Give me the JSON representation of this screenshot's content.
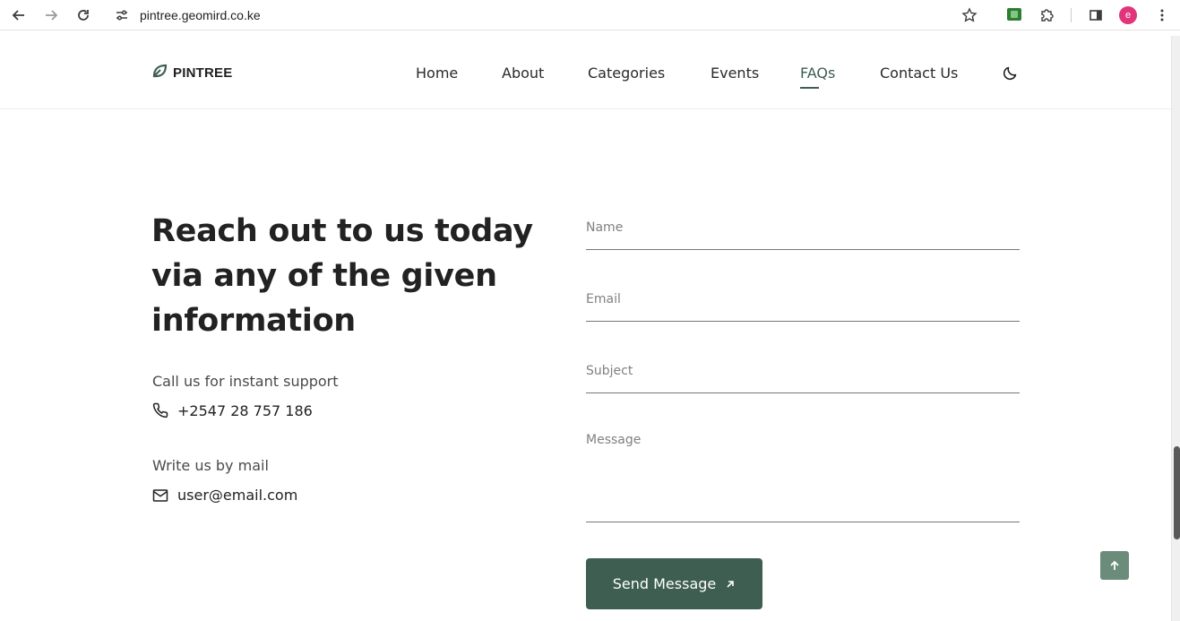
{
  "browser": {
    "url": "pintree.geomird.co.ke",
    "avatar_letter": "e"
  },
  "site": {
    "logo_text": "PINTREE",
    "nav": [
      {
        "label": "Home"
      },
      {
        "label": "About"
      },
      {
        "label": "Categories"
      },
      {
        "label": "Events"
      },
      {
        "label": "FAQs",
        "active": true
      },
      {
        "label": "Contact Us"
      }
    ],
    "accent_color": "#3d5e50"
  },
  "contact": {
    "headline_lines": [
      "Reach out to us today",
      "via any of the given",
      "information"
    ],
    "phone_label": "Call us for instant support",
    "phone": "+2547 28 757 186",
    "mail_label": "Write us by mail",
    "email": "user@email.com"
  },
  "form": {
    "name_placeholder": "Name",
    "email_placeholder": "Email",
    "subject_placeholder": "Subject",
    "message_placeholder": "Message",
    "submit_label": "Send Message"
  }
}
